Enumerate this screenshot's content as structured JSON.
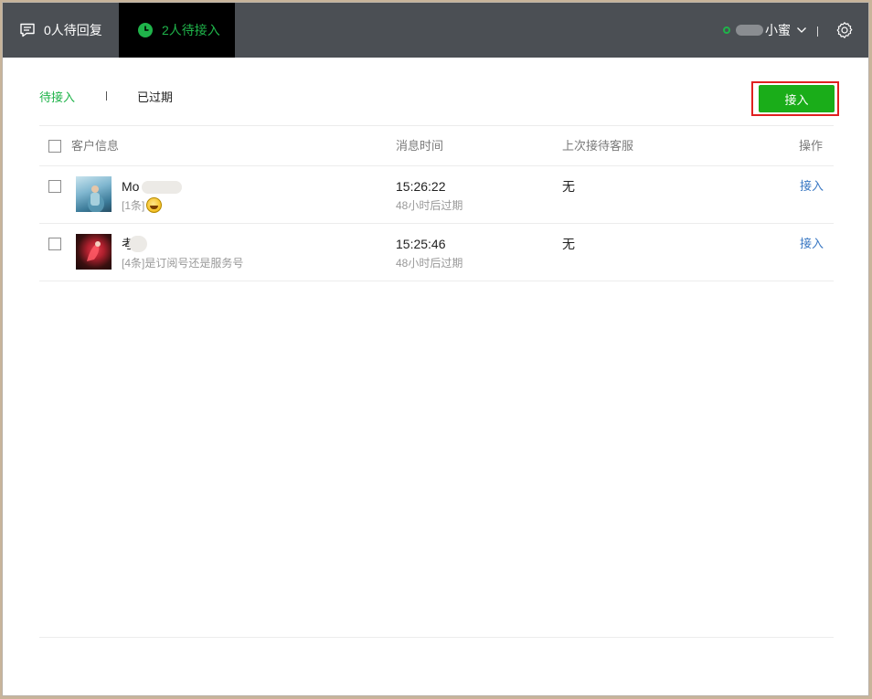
{
  "topbar": {
    "tab_reply": {
      "label": "0人待回复",
      "icon": "chat-list-icon"
    },
    "tab_pending": {
      "label": "2人待接入",
      "icon": "clock-icon"
    },
    "agent": {
      "name_visible": "小蜜",
      "status_color": "#1fb34a"
    },
    "settings_icon": "gear-icon"
  },
  "subtabs": {
    "pending": "待接入",
    "expired": "已过期"
  },
  "accept_button": "接入",
  "table": {
    "headers": {
      "customer": "客户信息",
      "time": "消息时间",
      "last_agent": "上次接待客服",
      "action": "操作"
    },
    "rows": [
      {
        "name": "Mo",
        "preview": "[1条]",
        "time": "15:26:22",
        "expire": "48小时后过期",
        "last_agent": "无",
        "action": "接入"
      },
      {
        "name": "考",
        "preview": "[4条]是订阅号还是服务号",
        "time": "15:25:46",
        "expire": "48小时后过期",
        "last_agent": "无",
        "action": "接入"
      }
    ]
  },
  "colors": {
    "accent_green": "#1aad19",
    "link_blue": "#3a78c3",
    "highlight_red": "#e02020",
    "topbar": "#4b4f54"
  }
}
